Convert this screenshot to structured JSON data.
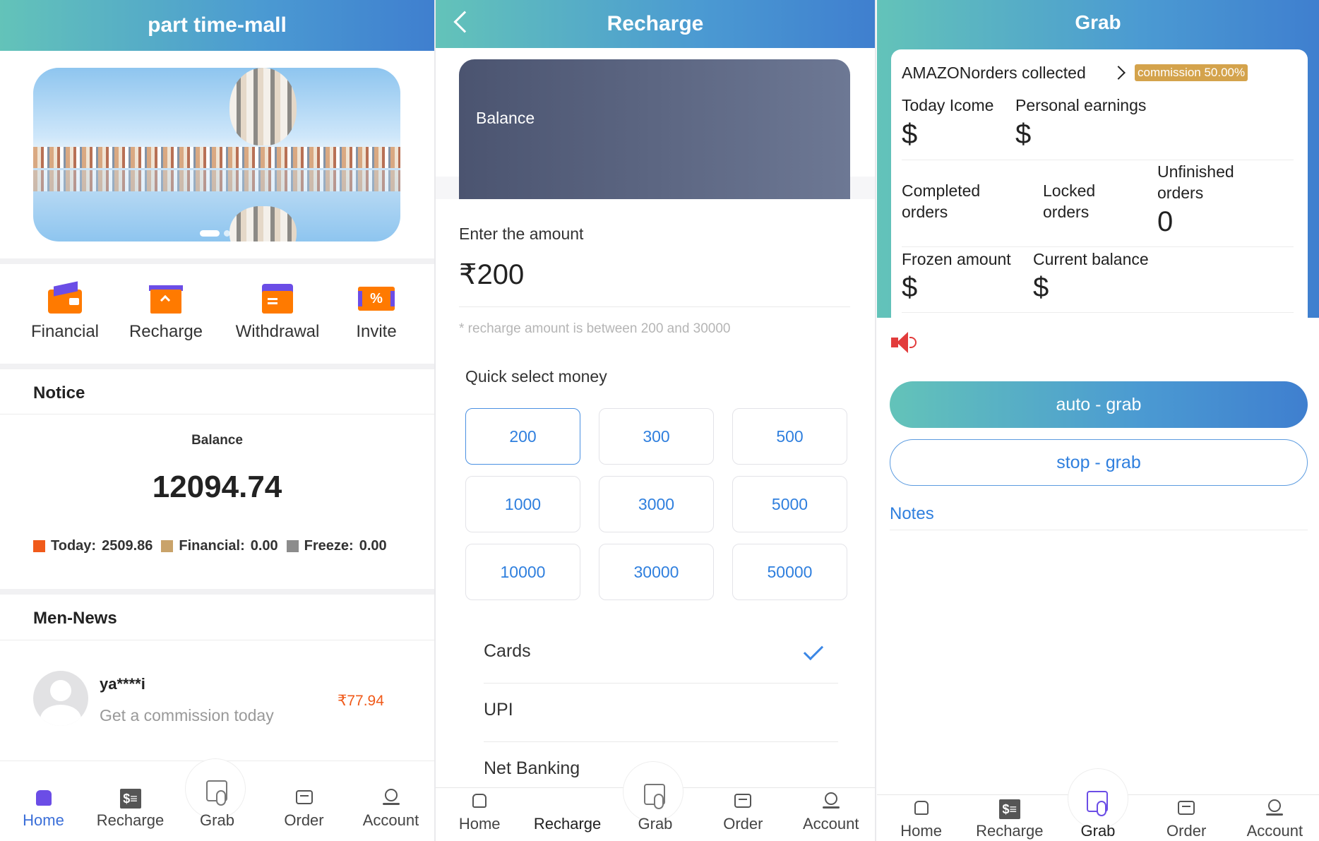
{
  "home": {
    "title": "part time-mall",
    "quick_links": [
      "Financial",
      "Recharge",
      "Withdrawal",
      "Invite"
    ],
    "notice_title": "Notice",
    "balance_label": "Balance",
    "balance_value": "12094.74",
    "legend": [
      {
        "label": "Today:",
        "value": "2509.86",
        "color": "#f05a1a"
      },
      {
        "label": "Financial:",
        "value": "0.00",
        "color": "#c9a36a"
      },
      {
        "label": "Freeze:",
        "value": "0.00",
        "color": "#8c8c8c"
      }
    ],
    "news_title": "Men-News",
    "news_item": {
      "user": "ya****i",
      "text": "Get a commission today",
      "amount": "₹77.94"
    },
    "nav": [
      "Home",
      "Recharge",
      "Grab",
      "Order",
      "Account"
    ]
  },
  "recharge": {
    "title": "Recharge",
    "card_label": "Balance",
    "enter_label": "Enter the amount",
    "amount_value": "₹200",
    "hint": "* recharge amount is between 200 and 30000",
    "quick_label": "Quick select money",
    "amounts": [
      "200",
      "300",
      "500",
      "1000",
      "3000",
      "5000",
      "10000",
      "30000",
      "50000"
    ],
    "payment_methods": [
      "Cards",
      "UPI",
      "Net Banking"
    ],
    "nav": [
      "Home",
      "Recharge",
      "Grab",
      "Order",
      "Account"
    ]
  },
  "grab": {
    "title": "Grab",
    "store_label": "AMAZONorders collected",
    "commission": "commission 50.00%",
    "today_income_label": "Today Icome",
    "personal_earnings_label": "Personal earnings",
    "dollar": "$",
    "completed_label": "Completed orders",
    "locked_label": "Locked orders",
    "unfinished_label": "Unfinished orders",
    "unfinished_value": "0",
    "frozen_label": "Frozen amount",
    "current_balance_label": "Current balance",
    "auto_button": "auto - grab",
    "stop_button": "stop - grab",
    "notes_label": "Notes",
    "nav": [
      "Home",
      "Recharge",
      "Grab",
      "Order",
      "Account"
    ]
  },
  "colors": {
    "accent_blue": "#2f7fde",
    "header_start": "#63c3b9",
    "header_end": "#3f7fcf",
    "orange": "#f05a1a"
  }
}
